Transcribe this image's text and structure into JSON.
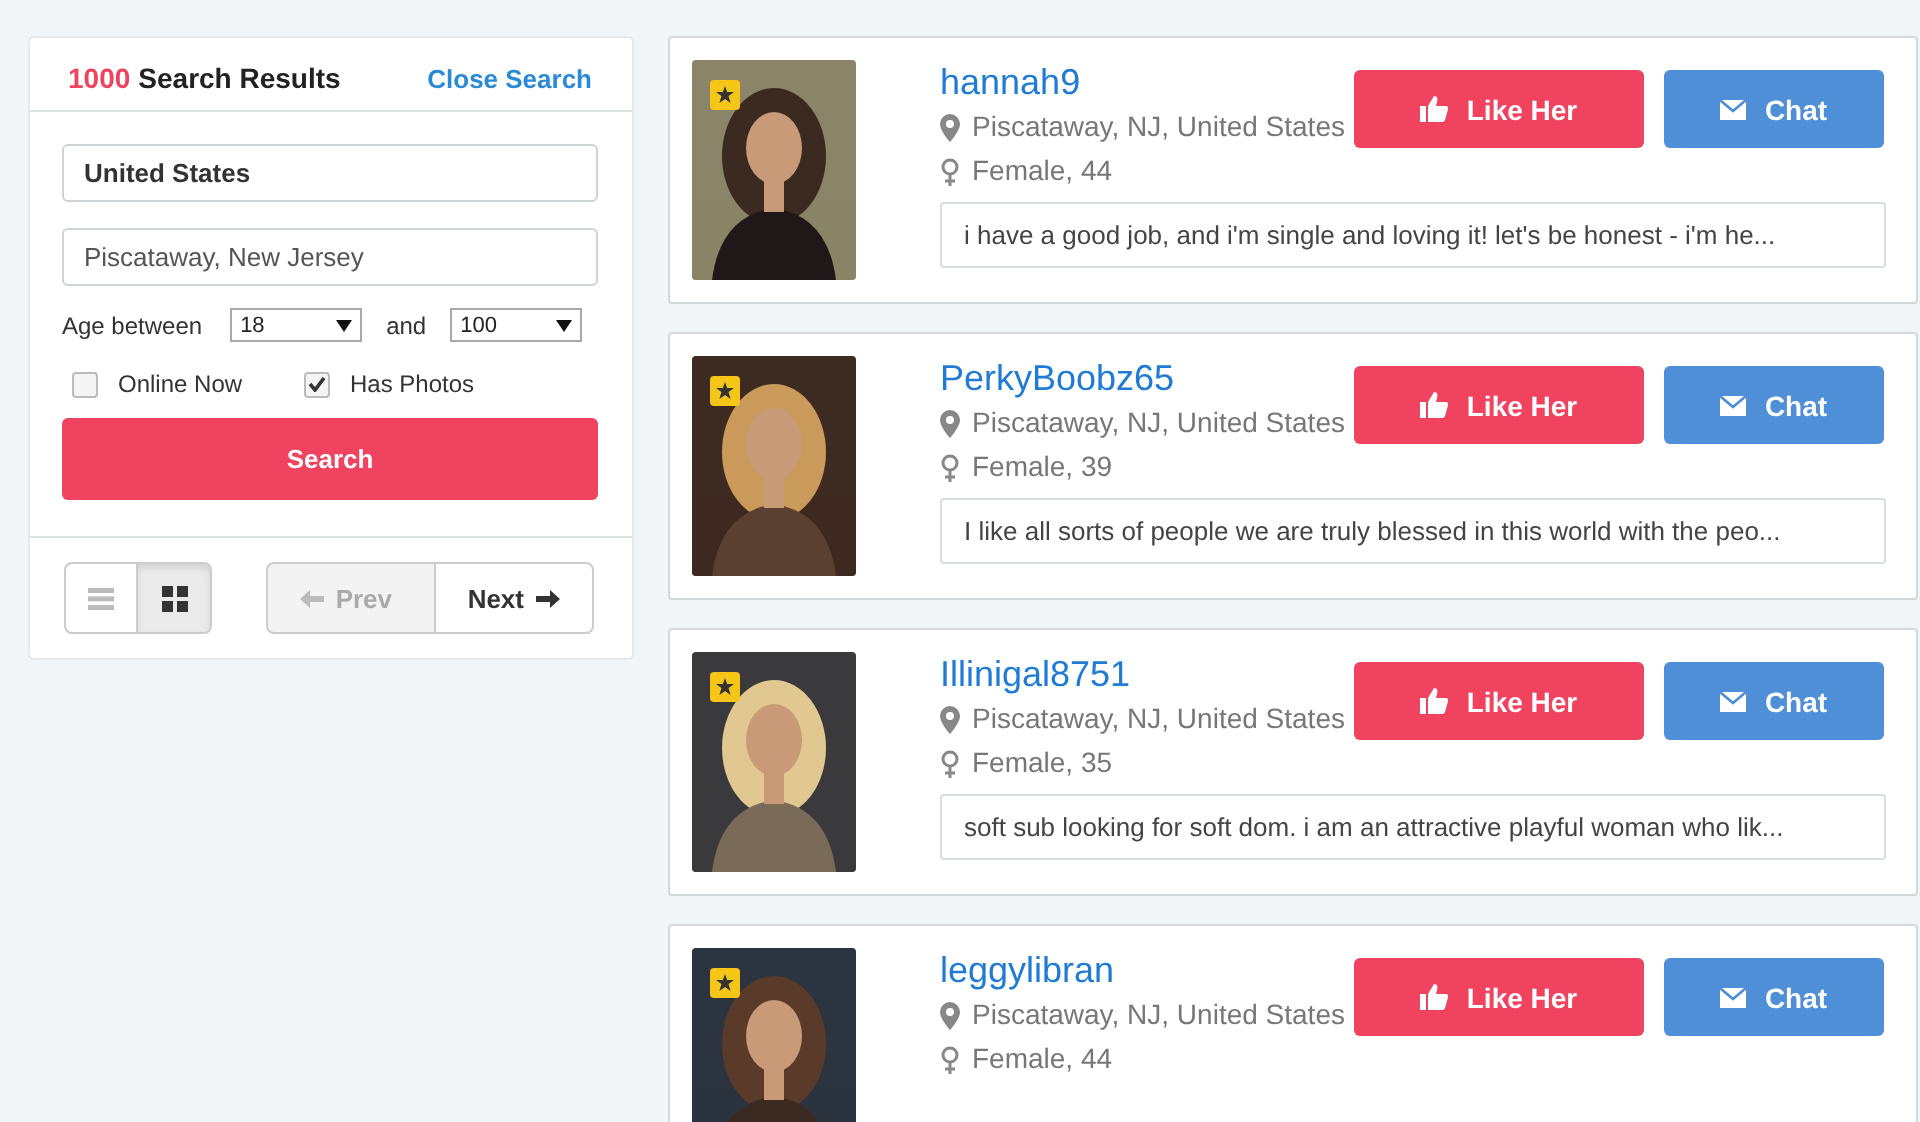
{
  "search_panel": {
    "result_count": "1000",
    "result_label": "Search Results",
    "close_link": "Close Search",
    "country": {
      "value": "United States"
    },
    "location": {
      "value": "Piscataway, New Jersey"
    },
    "age_label": "Age between",
    "age_min": "18",
    "age_joiner": "and",
    "age_max": "100",
    "filters": [
      {
        "label": "Online Now",
        "checked": false
      },
      {
        "label": "Has Photos",
        "checked": true
      }
    ],
    "search_button": "Search",
    "views": [
      {
        "kind": "list",
        "selected": false
      },
      {
        "kind": "grid",
        "selected": true
      }
    ],
    "pager": [
      {
        "kind": "prev",
        "label": "Prev",
        "disabled": true
      },
      {
        "kind": "next",
        "label": "Next",
        "disabled": false
      }
    ]
  },
  "results": [
    {
      "username": "hannah9",
      "featured": true,
      "location": "Piscataway, NJ, United States",
      "gender_age": "Female, 44",
      "like_button": "Like Her",
      "chat_button": "Chat",
      "about": "i have a good job, and i'm single and loving it! let's be honest - i'm he..."
    },
    {
      "username": "PerkyBoobz65",
      "featured": true,
      "location": "Piscataway, NJ, United States",
      "gender_age": "Female, 39",
      "like_button": "Like Her",
      "chat_button": "Chat",
      "about": "I like all sorts of people we are truly blessed in this world with the peo..."
    },
    {
      "username": "Illinigal8751",
      "featured": true,
      "location": "Piscataway, NJ, United States",
      "gender_age": "Female, 35",
      "like_button": "Like Her",
      "chat_button": "Chat",
      "about": "soft sub looking for soft dom. i am an attractive playful woman who lik..."
    },
    {
      "username": "leggylibran",
      "featured": true,
      "location": "Piscataway, NJ, United States",
      "gender_age": "Female, 44",
      "like_button": "Like Her",
      "chat_button": "Chat"
    }
  ]
}
